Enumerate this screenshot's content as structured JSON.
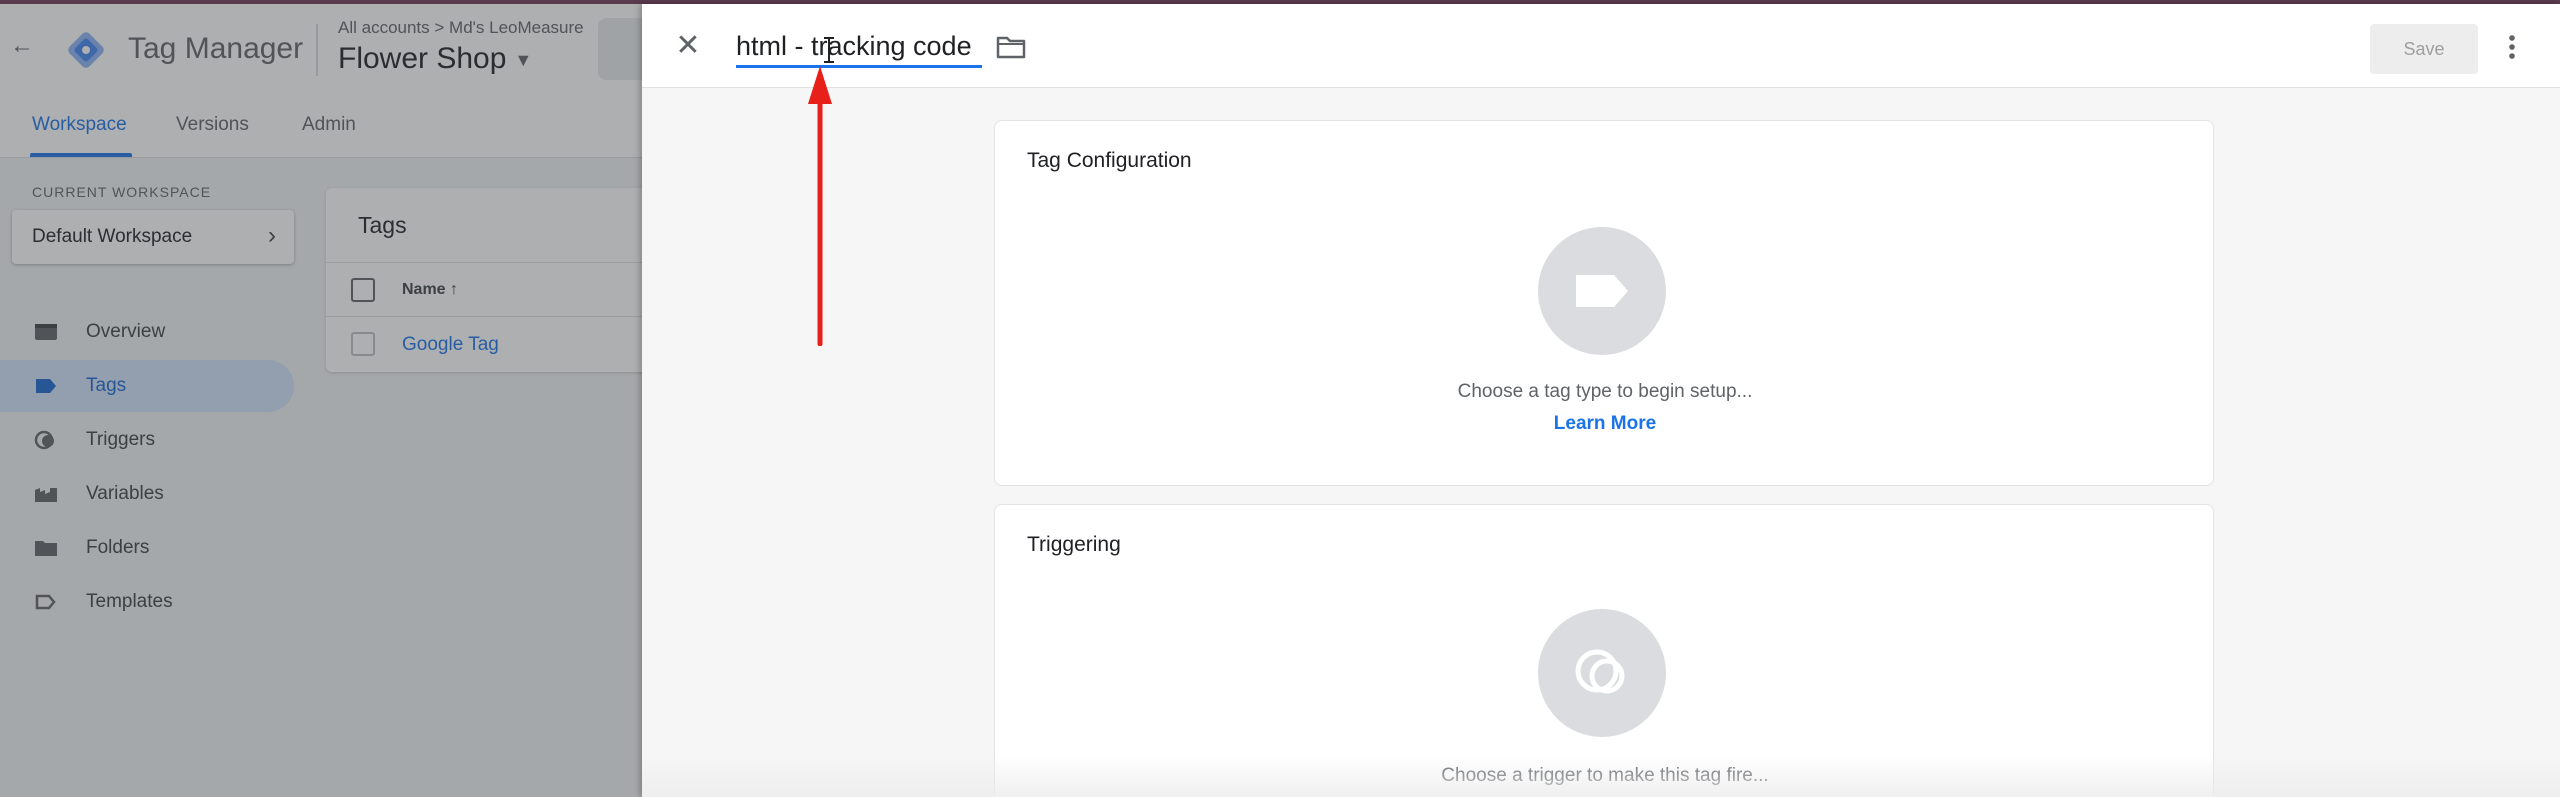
{
  "background_app": {
    "product_name": "Tag Manager",
    "breadcrumb": "All accounts > Md's LeoMeasure",
    "container_name": "Flower Shop",
    "tabs": [
      {
        "label": "Workspace",
        "active": true
      },
      {
        "label": "Versions",
        "active": false
      },
      {
        "label": "Admin",
        "active": false
      }
    ],
    "current_workspace_label": "CURRENT WORKSPACE",
    "current_workspace_name": "Default Workspace",
    "nav": [
      {
        "label": "Overview",
        "icon": "overview-icon",
        "active": false
      },
      {
        "label": "Tags",
        "icon": "tag-icon",
        "active": true
      },
      {
        "label": "Triggers",
        "icon": "trigger-icon",
        "active": false
      },
      {
        "label": "Variables",
        "icon": "variables-icon",
        "active": false
      },
      {
        "label": "Folders",
        "icon": "folder-icon",
        "active": false
      },
      {
        "label": "Templates",
        "icon": "template-icon",
        "active": false
      }
    ],
    "tags_table": {
      "title": "Tags",
      "column_name": "Name ↑",
      "rows": [
        {
          "name": "Google Tag"
        }
      ]
    }
  },
  "panel": {
    "tag_name": "html - tracking code",
    "save_label": "Save",
    "tag_configuration": {
      "title": "Tag Configuration",
      "hint": "Choose a tag type to begin setup...",
      "link": "Learn More"
    },
    "triggering": {
      "title": "Triggering",
      "hint": "Choose a trigger to make this tag fire..."
    }
  },
  "colors": {
    "accent": "#1a73e8",
    "annotation_arrow": "#e8201a",
    "active_nav_bg": "#d2e3fc"
  }
}
